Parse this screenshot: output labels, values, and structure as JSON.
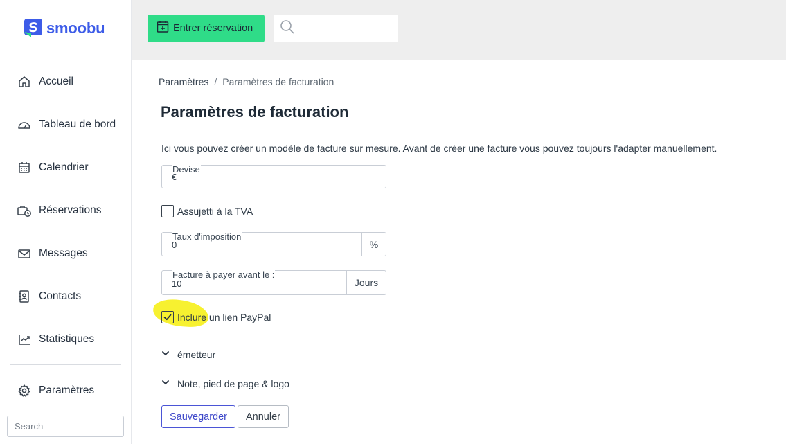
{
  "app": {
    "logo_text": "smoobu",
    "brand_color": "#3d5ce8",
    "accent_green": "#2fdc88"
  },
  "sidebar": {
    "items": [
      {
        "label": "Accueil",
        "icon": "home-icon"
      },
      {
        "label": "Tableau de bord",
        "icon": "dashboard-gauge-icon"
      },
      {
        "label": "Calendrier",
        "icon": "calendar-icon"
      },
      {
        "label": "Réservations",
        "icon": "briefcase-clock-icon"
      },
      {
        "label": "Messages",
        "icon": "envelope-icon"
      },
      {
        "label": "Contacts",
        "icon": "contact-card-icon"
      },
      {
        "label": "Statistiques",
        "icon": "chart-line-icon"
      },
      {
        "label": "Paramètres",
        "icon": "gear-icon"
      }
    ],
    "search_placeholder": "Search"
  },
  "topbar": {
    "reserve_button": "Entrer réservation",
    "search_icon": "search-icon"
  },
  "breadcrumb": {
    "parent": "Paramètres",
    "separator": "/",
    "current": "Paramètres de facturation"
  },
  "page": {
    "title": "Paramètres de facturation",
    "intro": "Ici vous pouvez créer un modèle de facture sur mesure. Avant de créer une facture vous pouvez toujours l'adapter manuellement."
  },
  "form": {
    "currency": {
      "label": "Devise",
      "value": "€"
    },
    "vat_checkbox": {
      "label": "Assujetti à la TVA",
      "checked": false
    },
    "tax_rate": {
      "label": "Taux d'imposition",
      "value": "0",
      "unit": "%"
    },
    "due": {
      "label": "Facture à payer avant le :",
      "value": "10",
      "unit": "Jours"
    },
    "paypal_checkbox": {
      "label": "Inclure un lien PayPal",
      "checked": true
    },
    "sections": [
      {
        "label": "émetteur"
      },
      {
        "label": "Note, pied de page & logo"
      }
    ],
    "save_button": "Sauvegarder",
    "cancel_button": "Annuler"
  }
}
